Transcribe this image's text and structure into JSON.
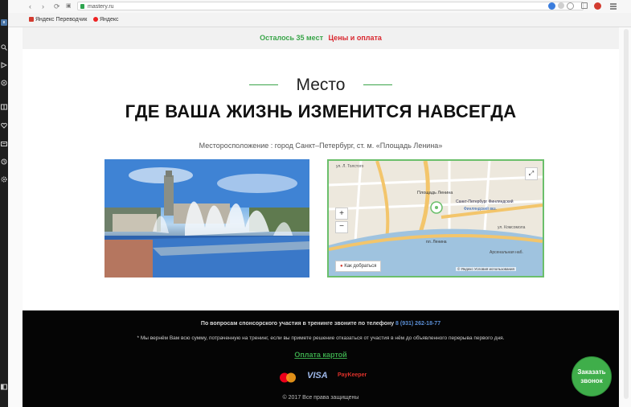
{
  "browser": {
    "url": "mastery.ru",
    "bookmarks": [
      "Яндекс Переводчик",
      "Яндекс"
    ]
  },
  "topbar": {
    "remaining": "Осталось 35 мест",
    "prices_link": "Цены и оплата"
  },
  "section": {
    "kicker": "Место",
    "headline": "ГДЕ ВАША ЖИЗНЬ ИЗМЕНИТСЯ НАВСЕГДА",
    "location": "Месторосположение : город Санкт–Петербург, ст. м. «Площадь Ленина»"
  },
  "map": {
    "labels": [
      "ул. Л. Толстого",
      "Площадь Ленина",
      "Санкт-Петербург Финляндский",
      "Финляндский вкз.",
      "Арсенальная наб.",
      "ул. Комсомола",
      "пл. Ленина"
    ],
    "how_to_get": "Как добраться",
    "copyright": "© Яндекс  Условия использования",
    "zoom_in": "+",
    "zoom_out": "−"
  },
  "footer": {
    "sponsor_text": "По вопросам спонсорского участия в тренинге звоните по телефону",
    "phone": "8 (931) 262-18-77",
    "refund_text": "* Мы вернём Вам всю сумму, потраченную на тренинг, если вы примете решение отказаться от участия в нём до объявленного перерыва первого дня.",
    "pay_link": "Оплата картой",
    "payment_logos": [
      "MasterCard",
      "VISA",
      "PayKeeper"
    ],
    "copyright": "© 2017 Все права защищены"
  },
  "call_button": {
    "line1": "Заказать",
    "line2": "звонок"
  },
  "colors": {
    "accent_green": "#3aa54a",
    "accent_red": "#d9272f",
    "footer_bg": "#050505"
  }
}
